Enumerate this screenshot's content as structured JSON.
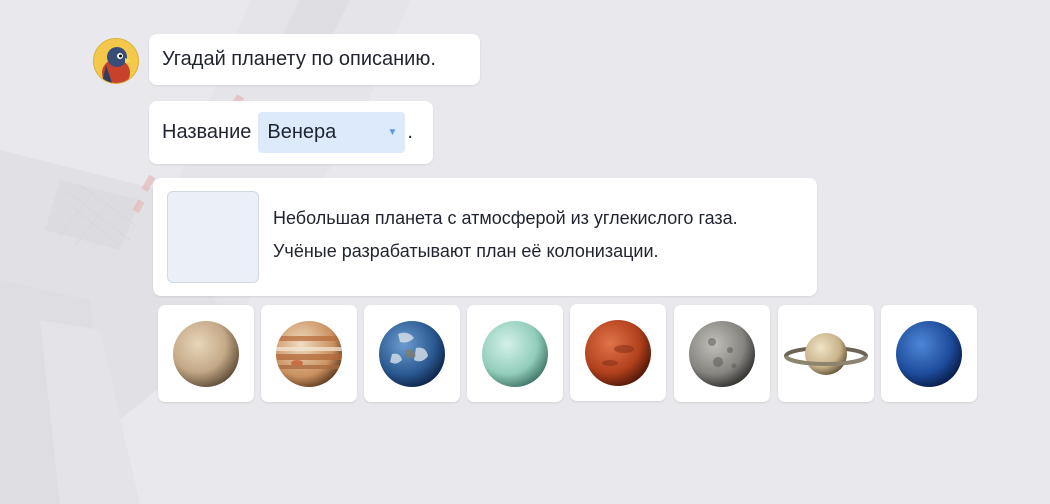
{
  "question": "Угадай планету по описанию.",
  "name_label": "Название",
  "name_select": {
    "value": "Венера",
    "suffix": "."
  },
  "description_lines": [
    "Небольшая планета с атмосферой из углекислого газа.",
    "Учёные разрабатывают план её колонизации."
  ],
  "planet_tiles": [
    {
      "icon": "venus-planet-icon",
      "color": "#c9b08f"
    },
    {
      "icon": "jupiter-planet-icon",
      "color": "#c98a5a"
    },
    {
      "icon": "earth-planet-icon",
      "color": "#2f5d93"
    },
    {
      "icon": "uranus-planet-icon",
      "color": "#9fd9c8"
    },
    {
      "icon": "mars-planet-icon",
      "color": "#b5431f"
    },
    {
      "icon": "mercury-planet-icon",
      "color": "#8a8883"
    },
    {
      "icon": "saturn-planet-icon",
      "color": "#cdbb94"
    },
    {
      "icon": "neptune-planet-icon",
      "color": "#1f4fa0"
    }
  ],
  "colors": {
    "background": "#e9e9ed",
    "select_bg": "#ddeafb",
    "accent": "#5b9bdc"
  }
}
